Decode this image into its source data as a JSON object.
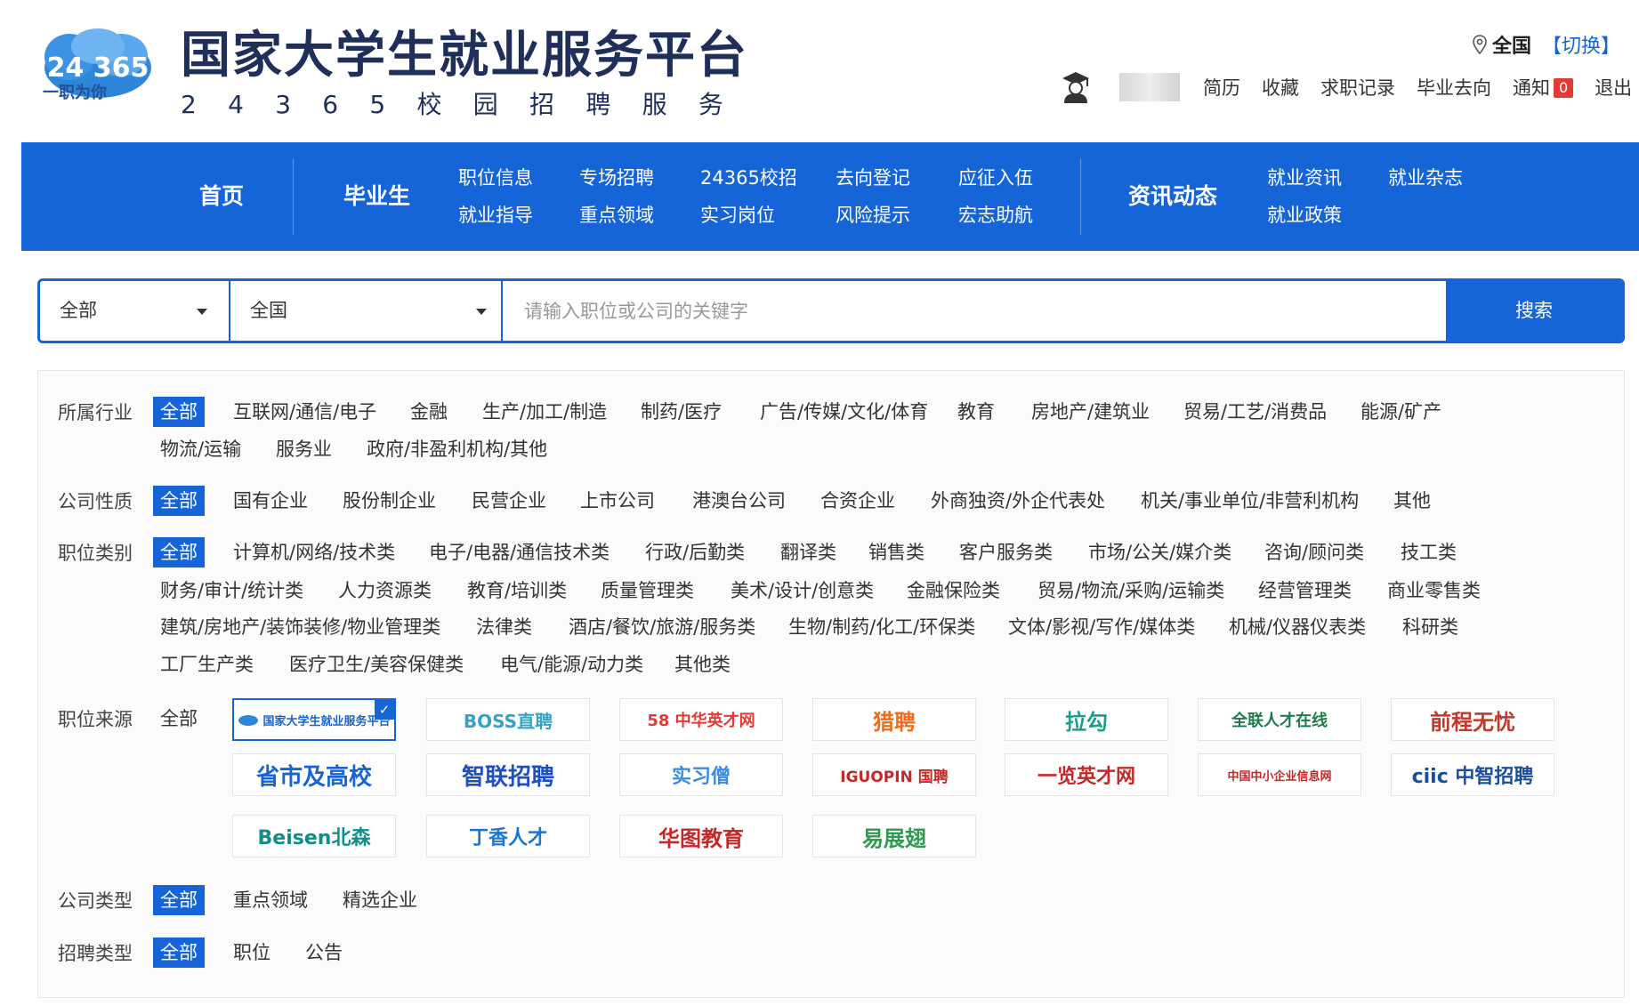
{
  "header": {
    "logo_number": "24 365",
    "logo_tagline": "一职为你",
    "title": "国家大学生就业服务平台",
    "subtitle": [
      "2",
      "4",
      "3",
      "6",
      "5",
      "校",
      "园",
      "招",
      "聘",
      "服",
      "务"
    ],
    "location": "全国",
    "switch_label": "【切换】",
    "user_links": [
      "简历",
      "收藏",
      "求职记录",
      "毕业去向"
    ],
    "notice_label": "通知",
    "notice_count": "0",
    "logout_label": "退出"
  },
  "nav": {
    "home": "首页",
    "graduates": "毕业生",
    "links_col1": [
      "职位信息",
      "就业指导"
    ],
    "links_col2": [
      "专场招聘",
      "重点领域"
    ],
    "links_col3": [
      "24365校招",
      "实习岗位"
    ],
    "links_col4": [
      "去向登记",
      "风险提示"
    ],
    "links_col5": [
      "应征入伍",
      "宏志助航"
    ],
    "news": "资讯动态",
    "news_col1": [
      "就业资讯",
      "就业政策"
    ],
    "news_col2": [
      "就业杂志"
    ]
  },
  "search": {
    "category_value": "全部",
    "region_value": "全国",
    "placeholder": "请输入职位或公司的关键字",
    "button": "搜索"
  },
  "filters": {
    "industry": {
      "label": "所属行业",
      "options": [
        "全部",
        "互联网/通信/电子",
        "金融",
        "生产/加工/制造",
        "制药/医疗",
        "广告/传媒/文化/体育",
        "教育",
        "房地产/建筑业",
        "贸易/工艺/消费品",
        "能源/矿产",
        "物流/运输",
        "服务业",
        "政府/非盈利机构/其他"
      ]
    },
    "company_nature": {
      "label": "公司性质",
      "options": [
        "全部",
        "国有企业",
        "股份制企业",
        "民营企业",
        "上市公司",
        "港澳台公司",
        "合资企业",
        "外商独资/外企代表处",
        "机关/事业单位/非营利机构",
        "其他"
      ]
    },
    "job_category": {
      "label": "职位类别",
      "options": [
        "全部",
        "计算机/网络/技术类",
        "电子/电器/通信技术类",
        "行政/后勤类",
        "翻译类",
        "销售类",
        "客户服务类",
        "市场/公关/媒介类",
        "咨询/顾问类",
        "技工类",
        "财务/审计/统计类",
        "人力资源类",
        "教育/培训类",
        "质量管理类",
        "美术/设计/创意类",
        "金融保险类",
        "贸易/物流/采购/运输类",
        "经营管理类",
        "商业零售类",
        "建筑/房地产/装饰装修/物业管理类",
        "法律类",
        "酒店/餐饮/旅游/服务类",
        "生物/制药/化工/环保类",
        "文体/影视/写作/媒体类",
        "机械/仪器仪表类",
        "科研类",
        "工厂生产类",
        "医疗卫生/美容保健类",
        "电气/能源/动力类",
        "其他类"
      ]
    },
    "job_source": {
      "label": "职位来源",
      "all": "全部",
      "logos": [
        "国家大学生就业服务平台",
        "BOSS直聘",
        "58 中华英才网",
        "猎聘",
        "拉勾",
        "全联人才在线",
        "前程无忧",
        "省市及高校",
        "智联招聘",
        "实习僧",
        "IGUOPIN 国聘",
        "一览英才网",
        "中国中小企业信息网",
        "ciic 中智招聘",
        "Beisen北森",
        "丁香人才",
        "华图教育",
        "易展翅"
      ],
      "checked_mark": "✓"
    },
    "company_type": {
      "label": "公司类型",
      "options": [
        "全部",
        "重点领域",
        "精选企业"
      ]
    },
    "recruit_type": {
      "label": "招聘类型",
      "options": [
        "全部",
        "职位",
        "公告"
      ]
    }
  },
  "colors": {
    "primary": "#1565d8",
    "badge": "#e53935",
    "title": "#1f2f5a"
  }
}
